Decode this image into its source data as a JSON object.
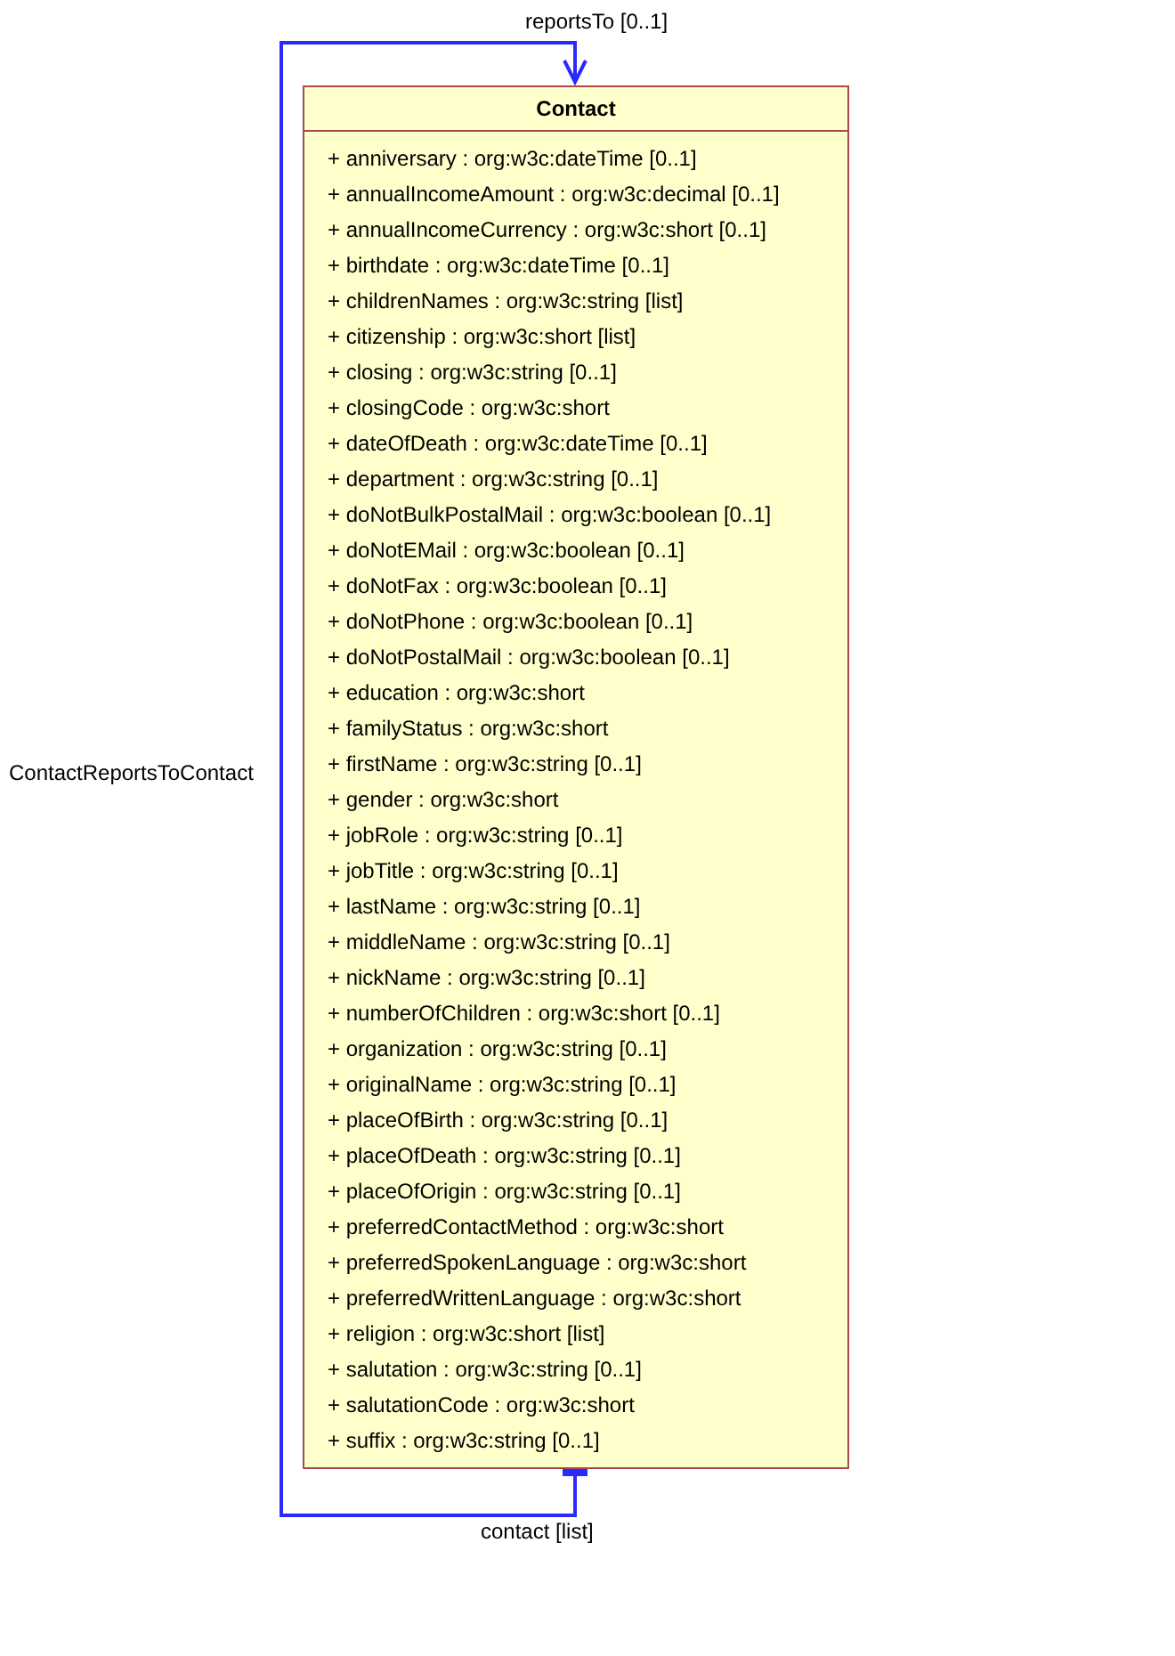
{
  "association": {
    "name": "ContactReportsToContact",
    "target_role": "reportsTo [0..1]",
    "source_role": "contact [list]"
  },
  "class": {
    "name": "Contact",
    "attributes": [
      "+ anniversary : org:w3c:dateTime [0..1]",
      "+ annualIncomeAmount : org:w3c:decimal [0..1]",
      "+ annualIncomeCurrency : org:w3c:short [0..1]",
      "+ birthdate : org:w3c:dateTime [0..1]",
      "+ childrenNames : org:w3c:string [list]",
      "+ citizenship : org:w3c:short [list]",
      "+ closing : org:w3c:string [0..1]",
      "+ closingCode : org:w3c:short",
      "+ dateOfDeath : org:w3c:dateTime [0..1]",
      "+ department : org:w3c:string [0..1]",
      "+ doNotBulkPostalMail : org:w3c:boolean [0..1]",
      "+ doNotEMail : org:w3c:boolean [0..1]",
      "+ doNotFax : org:w3c:boolean [0..1]",
      "+ doNotPhone : org:w3c:boolean [0..1]",
      "+ doNotPostalMail : org:w3c:boolean [0..1]",
      "+ education : org:w3c:short",
      "+ familyStatus : org:w3c:short",
      "+ firstName : org:w3c:string [0..1]",
      "+ gender : org:w3c:short",
      "+ jobRole : org:w3c:string [0..1]",
      "+ jobTitle : org:w3c:string [0..1]",
      "+ lastName : org:w3c:string [0..1]",
      "+ middleName : org:w3c:string [0..1]",
      "+ nickName : org:w3c:string [0..1]",
      "+ numberOfChildren : org:w3c:short [0..1]",
      "+ organization : org:w3c:string [0..1]",
      "+ originalName : org:w3c:string [0..1]",
      "+ placeOfBirth : org:w3c:string [0..1]",
      "+ placeOfDeath : org:w3c:string [0..1]",
      "+ placeOfOrigin : org:w3c:string [0..1]",
      "+ preferredContactMethod : org:w3c:short",
      "+ preferredSpokenLanguage : org:w3c:short",
      "+ preferredWrittenLanguage : org:w3c:short",
      "+ religion : org:w3c:short [list]",
      "+ salutation : org:w3c:string [0..1]",
      "+ salutationCode : org:w3c:short",
      "+ suffix : org:w3c:string [0..1]"
    ]
  }
}
